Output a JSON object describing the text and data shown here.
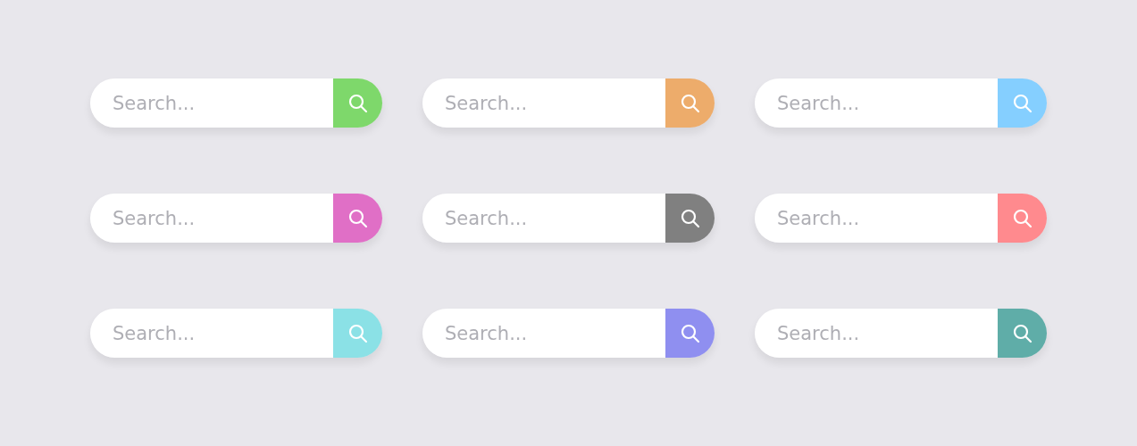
{
  "search_bars": [
    {
      "placeholder": "Search...",
      "color": "#7ed86b"
    },
    {
      "placeholder": "Search...",
      "color": "#edac6b"
    },
    {
      "placeholder": "Search...",
      "color": "#85cfff"
    },
    {
      "placeholder": "Search...",
      "color": "#e06fc6"
    },
    {
      "placeholder": "Search...",
      "color": "#808080"
    },
    {
      "placeholder": "Search...",
      "color": "#ff8a8e"
    },
    {
      "placeholder": "Search...",
      "color": "#8be1e6"
    },
    {
      "placeholder": "Search...",
      "color": "#8f8ff0"
    },
    {
      "placeholder": "Search...",
      "color": "#5fada8"
    }
  ]
}
